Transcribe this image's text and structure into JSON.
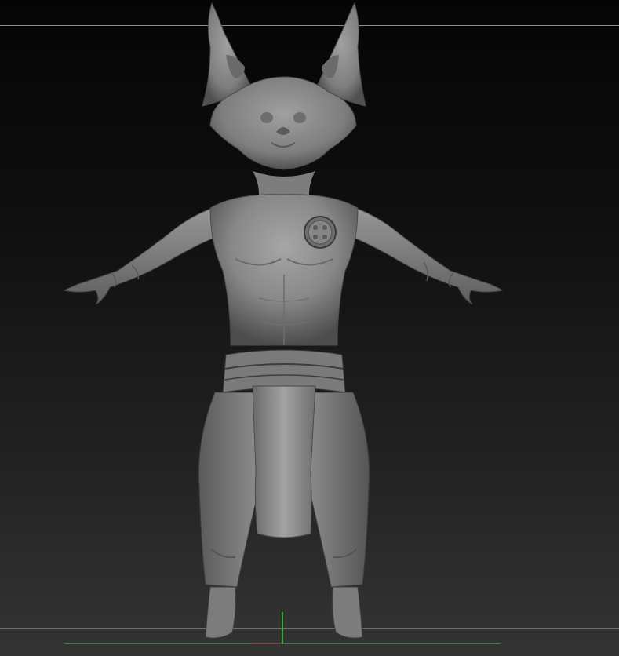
{
  "viewport": {
    "model_name": "",
    "colors": {
      "sculpt_clay": "#8c8c8c",
      "floor_axis_x": "#3f7a3f",
      "floor_axis_y": "#2fae2f",
      "guide_line": "#8a8a8a"
    }
  }
}
